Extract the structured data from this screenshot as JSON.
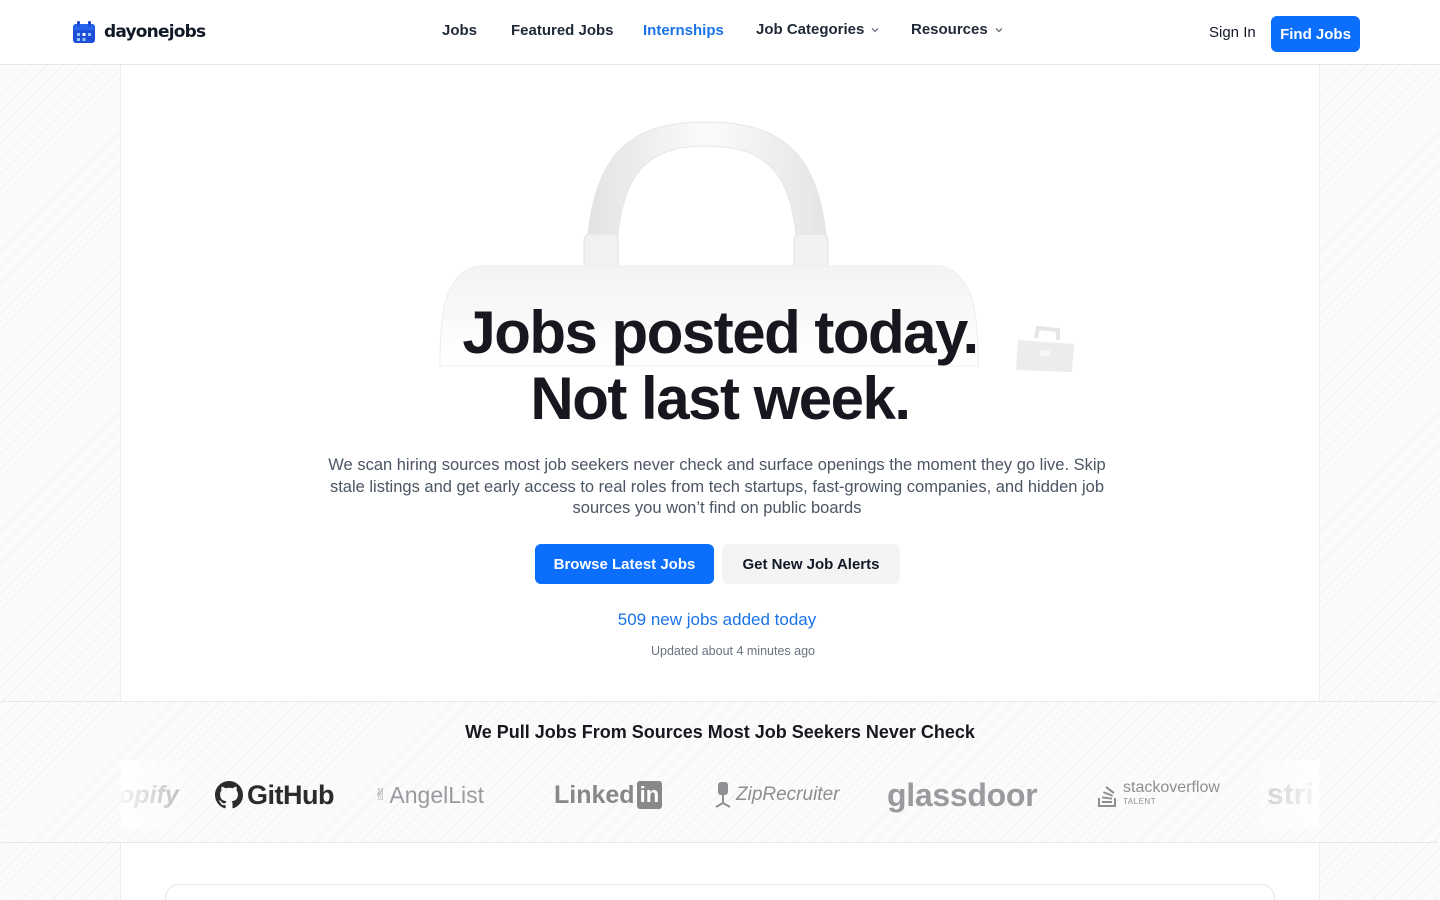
{
  "brand": {
    "name": "dayonejobs",
    "accent": "#0b6efd",
    "link_color": "#1a73e8"
  },
  "nav": {
    "items": [
      {
        "label": "Jobs",
        "active": false
      },
      {
        "label": "Featured Jobs",
        "active": false
      },
      {
        "label": "Internships",
        "active": true
      },
      {
        "label": "Job Categories",
        "has_dropdown": true
      },
      {
        "label": "Resources",
        "has_dropdown": true
      }
    ],
    "sign_in": "Sign In",
    "cta": "Find Jobs"
  },
  "hero": {
    "title_line1": "Jobs posted today.",
    "title_line2": "Not last week.",
    "subtitle": "We scan hiring sources most job seekers never check and surface openings the moment they go live. Skip stale listings and get early access to real roles from tech startups, fast-growing companies, and hidden job sources you won’t find on public boards",
    "primary_button": "Browse Latest Jobs",
    "secondary_button": "Get New Job Alerts",
    "new_jobs_text": "509 new jobs added today",
    "updated_text": "Updated about 4 minutes ago"
  },
  "sources": {
    "title": "We Pull Jobs From Sources Most Job Seekers Never Check",
    "logos": {
      "shopify": "opify",
      "github": "GitHub",
      "angellist": "AngelList",
      "linkedin": "Linked",
      "linkedin_in": "in",
      "ziprecruiter": "ZipRecruiter",
      "glassdoor": "glassdoor",
      "stackoverflow": "stackoverflow",
      "stackoverflow_sub": "TALENT",
      "stripe": "stri"
    }
  }
}
